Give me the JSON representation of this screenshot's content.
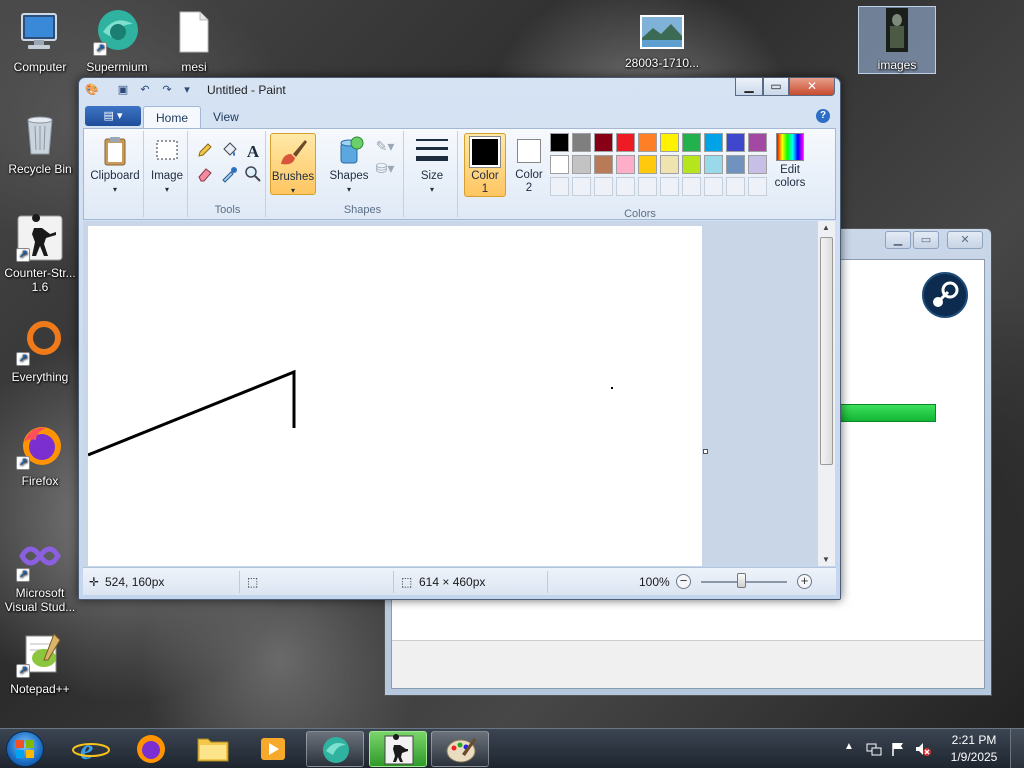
{
  "desktop": {
    "icons": [
      {
        "label": "Computer"
      },
      {
        "label": "Supermium"
      },
      {
        "label": "mesi"
      },
      {
        "label": "28003-1710..."
      },
      {
        "label": "images"
      },
      {
        "label": "Recycle Bin"
      },
      {
        "label": "Counter-Str...\n1.6",
        "line1": "Counter-Str...",
        "line2": "1.6"
      },
      {
        "label": "Everything"
      },
      {
        "label": "Firefox"
      },
      {
        "label": "Microsoft Visual Stud...",
        "line1": "Microsoft",
        "line2": "Visual Stud..."
      },
      {
        "label": "Notepad++"
      }
    ]
  },
  "paint": {
    "title": "Untitled - Paint",
    "tabs": [
      {
        "label": "Home"
      },
      {
        "label": "View"
      }
    ],
    "ribbon": {
      "clipboard_label": "Clipboard",
      "image_label": "Image",
      "tools_group": "Tools",
      "brushes_label": "Brushes",
      "shapes_label": "Shapes",
      "shapes_group": "Shapes",
      "size_label": "Size",
      "color1_label_a": "Color",
      "color1_label_b": "1",
      "color2_label_a": "Color",
      "color2_label_b": "2",
      "colors_group": "Colors",
      "edit_colors_a": "Edit",
      "edit_colors_b": "colors"
    },
    "palette_row1": [
      "#000000",
      "#7f7f7f",
      "#880015",
      "#ed1c24",
      "#ff7f27",
      "#fff200",
      "#22b14c",
      "#00a2e8",
      "#3f48cc",
      "#a349a4"
    ],
    "palette_row2": [
      "#ffffff",
      "#c3c3c3",
      "#b97a57",
      "#ffaec9",
      "#ffc90e",
      "#efe4b0",
      "#b5e61d",
      "#99d9ea",
      "#7092be",
      "#c8bfe7"
    ],
    "color1": "#000000",
    "color2": "#ffffff",
    "status": {
      "cursor_pos": "524, 160px",
      "canvas_size": "614 × 460px",
      "zoom": "100%"
    }
  },
  "taskbar": {
    "time": "2:21 PM",
    "date": "1/9/2025"
  }
}
